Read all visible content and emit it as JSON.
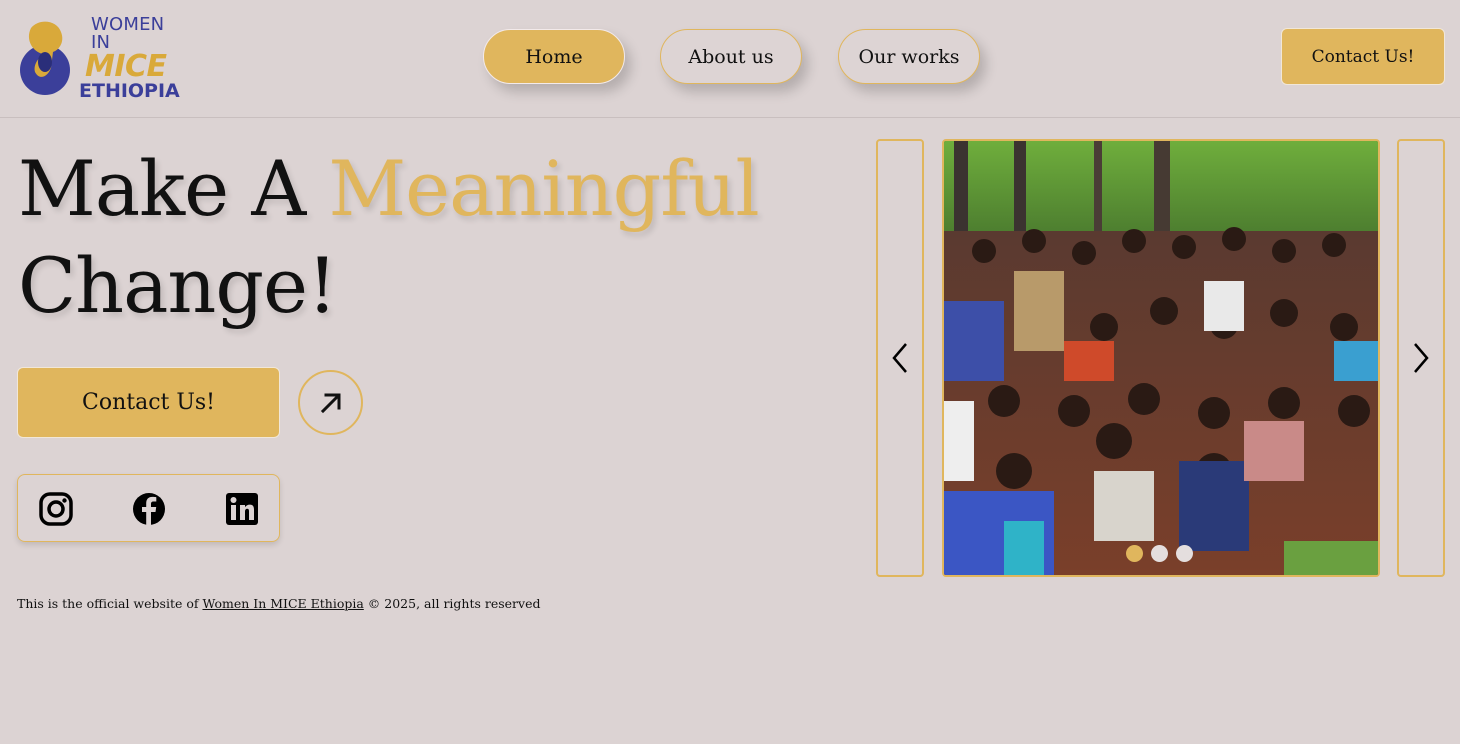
{
  "brand": {
    "logo_line1": "WOMEN IN",
    "logo_line2": "MICE",
    "logo_line3": "ETHIOPIA",
    "colors": {
      "accent": "#e0b65d",
      "brand_blue": "#3b3f9a",
      "background": "#dcd3d3"
    }
  },
  "nav": {
    "items": [
      {
        "label": "Home",
        "active": true
      },
      {
        "label": "About us",
        "active": false
      },
      {
        "label": "Our works",
        "active": false
      }
    ],
    "contact_label": "Contact Us!"
  },
  "hero": {
    "title_part1": "Make A ",
    "title_accent": "Meaningful",
    "title_part2": "Change!",
    "cta_label": "Contact Us!",
    "arrow_icon": "arrow-up-right-icon"
  },
  "social": {
    "items": [
      {
        "name": "instagram-icon"
      },
      {
        "name": "facebook-icon"
      },
      {
        "name": "linkedin-icon"
      }
    ]
  },
  "footer": {
    "prefix": "This is the official website of ",
    "link": "Women In MICE Ethiopia",
    "suffix": " © 2025, all rights reserved"
  },
  "carousel": {
    "prev_icon": "chevron-left-icon",
    "next_icon": "chevron-right-icon",
    "slide_count": 3,
    "active_slide": 1
  }
}
